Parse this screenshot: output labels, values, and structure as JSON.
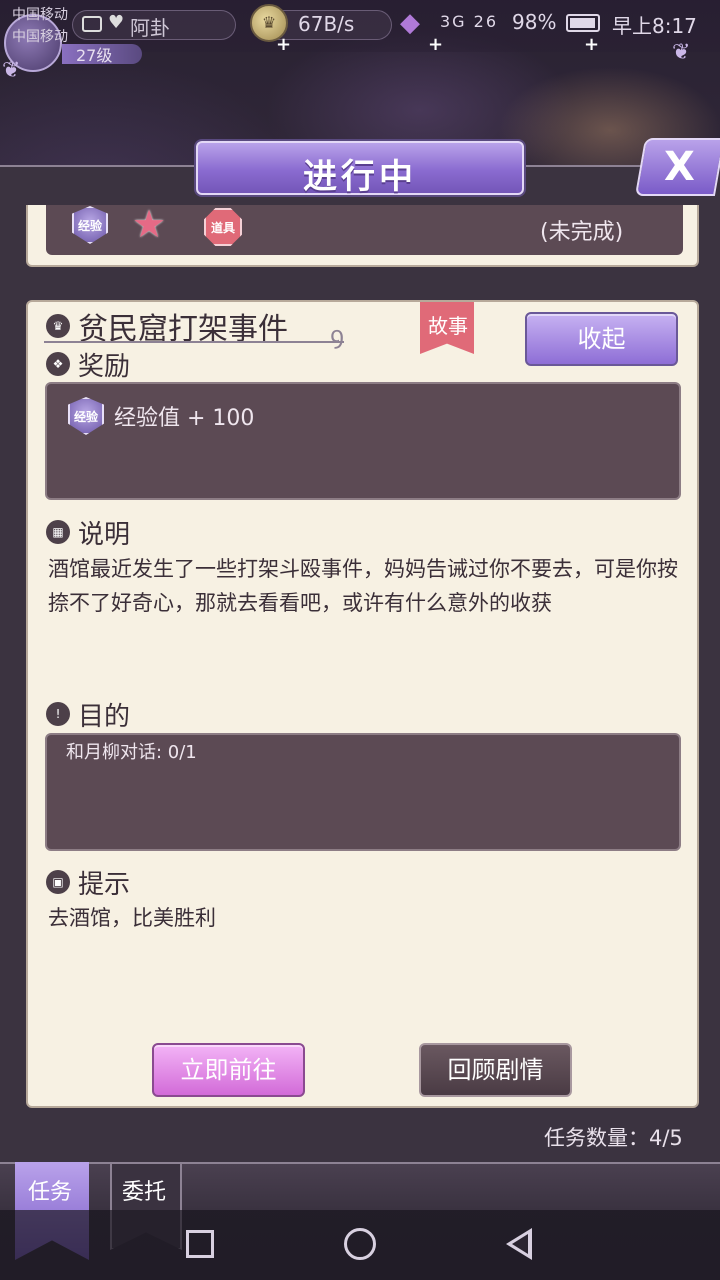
{
  "status_bar": {
    "carrier_1": "中国移动",
    "carrier_2": "中国移动",
    "player_name": "阿卦",
    "level": "27级",
    "net_speed": "67B/s",
    "signal": "3G 26",
    "battery": "98%",
    "time": "早上8:17"
  },
  "header": {
    "title": "进行中",
    "close_label": "X"
  },
  "previous_quest": {
    "exp_badge": "经验",
    "item_badge": "道具",
    "status": "(未完成)"
  },
  "quest": {
    "title": "贫民窟打架事件",
    "tag": "故事",
    "collapse_label": "收起",
    "reward_label": "奖励",
    "reward_badge": "经验",
    "reward_text": "经验值 + 100",
    "description_label": "说明",
    "description": "酒馆最近发生了一些打架斗殴事件，妈妈告诫过你不要去，可是你按捺不了好奇心，那就去看看吧，或许有什么意外的收获",
    "goal_label": "目的",
    "goal": "和月柳对话: 0/1",
    "hint_label": "提示",
    "hint": "去酒馆，比美胜利",
    "go_label": "立即前往",
    "review_label": "回顾剧情"
  },
  "quest_count": "任务数量：4/5",
  "tabs": {
    "quest": "任务",
    "entrust": "委托"
  },
  "colors": {
    "accent_purple": "#8a6bd0",
    "card_bg": "#f7f1e3",
    "dark_box": "#5c4a54",
    "story_tag": "#e06a78",
    "go_button": "#d26bd8"
  }
}
